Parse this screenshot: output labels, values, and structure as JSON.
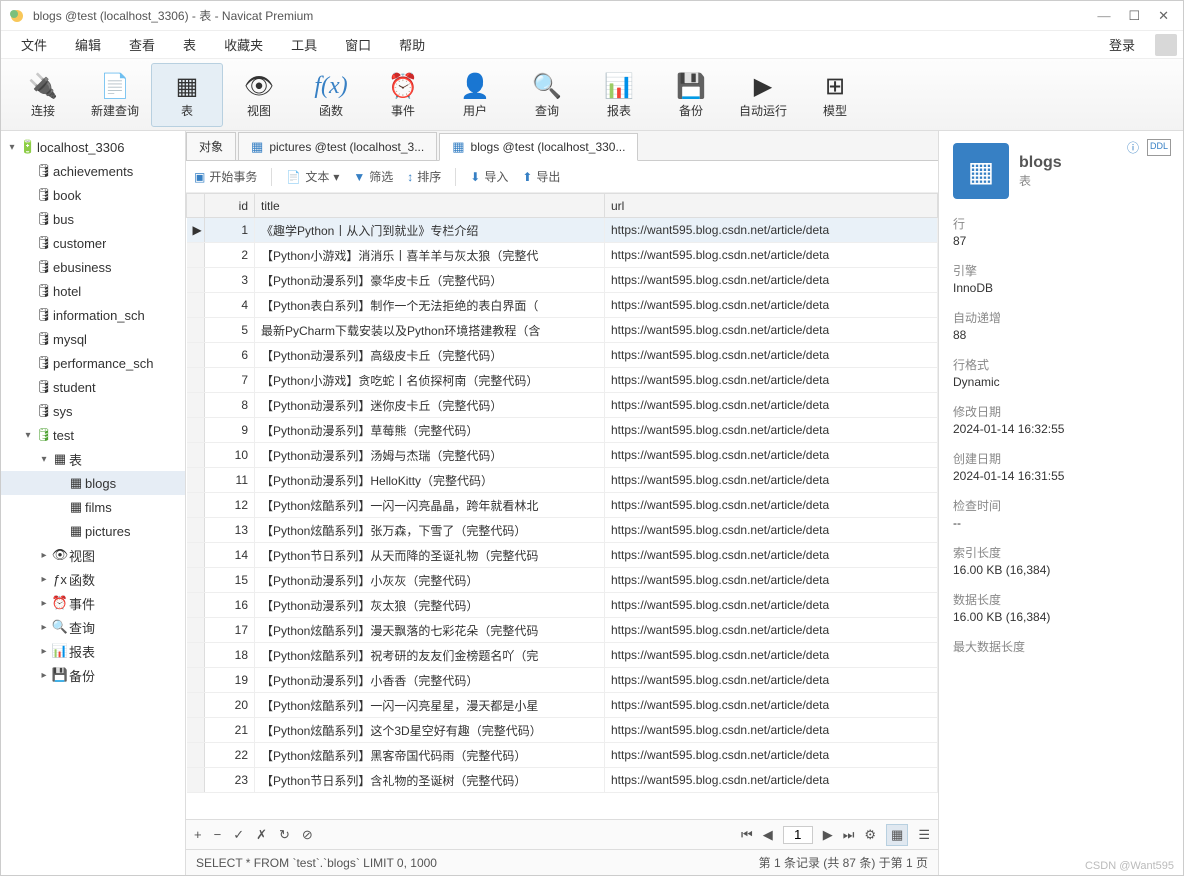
{
  "window": {
    "title": "blogs @test (localhost_3306) - 表 - Navicat Premium"
  },
  "menu": {
    "items": [
      "文件",
      "编辑",
      "查看",
      "表",
      "收藏夹",
      "工具",
      "窗口",
      "帮助"
    ],
    "login": "登录"
  },
  "toolbar": [
    {
      "label": "连接",
      "icon": "🔌"
    },
    {
      "label": "新建查询",
      "icon": "📄"
    },
    {
      "label": "表",
      "icon": "▦",
      "active": true
    },
    {
      "label": "视图",
      "icon": "👁"
    },
    {
      "label": "函数",
      "icon": "f(x)",
      "fx": true
    },
    {
      "label": "事件",
      "icon": "⏰"
    },
    {
      "label": "用户",
      "icon": "👤"
    },
    {
      "label": "查询",
      "icon": "🔍"
    },
    {
      "label": "报表",
      "icon": "📊"
    },
    {
      "label": "备份",
      "icon": "💾"
    },
    {
      "label": "自动运行",
      "icon": "▶"
    },
    {
      "label": "模型",
      "icon": "⊞"
    }
  ],
  "tree": {
    "conn": "localhost_3306",
    "dbs": [
      "achievements",
      "book",
      "bus",
      "customer",
      "ebusiness",
      "hotel",
      "information_sch",
      "mysql",
      "performance_sch",
      "student",
      "sys"
    ],
    "activeDb": "test",
    "tablesLabel": "表",
    "tables": [
      "blogs",
      "films",
      "pictures"
    ],
    "activeTable": "blogs",
    "folders": [
      "视图",
      "函数",
      "事件",
      "查询",
      "报表",
      "备份"
    ]
  },
  "tabs": [
    {
      "label": "对象",
      "icon": ""
    },
    {
      "label": "pictures @test (localhost_3...",
      "icon": "▦"
    },
    {
      "label": "blogs @test (localhost_330...",
      "icon": "▦",
      "active": true
    }
  ],
  "subToolbar": {
    "begin": "开始事务",
    "text": "文本",
    "filter": "筛选",
    "sort": "排序",
    "import": "导入",
    "export": "导出"
  },
  "columns": [
    "id",
    "title",
    "url"
  ],
  "rows": [
    {
      "id": 1,
      "title": "《趣学Python丨从入门到就业》专栏介绍",
      "url": "https://want595.blog.csdn.net/article/deta"
    },
    {
      "id": 2,
      "title": "【Python小游戏】消消乐丨喜羊羊与灰太狼（完整代",
      "url": "https://want595.blog.csdn.net/article/deta"
    },
    {
      "id": 3,
      "title": "【Python动漫系列】豪华皮卡丘（完整代码）",
      "url": "https://want595.blog.csdn.net/article/deta"
    },
    {
      "id": 4,
      "title": "【Python表白系列】制作一个无法拒绝的表白界面（",
      "url": "https://want595.blog.csdn.net/article/deta"
    },
    {
      "id": 5,
      "title": "最新PyCharm下载安装以及Python环境搭建教程（含",
      "url": "https://want595.blog.csdn.net/article/deta"
    },
    {
      "id": 6,
      "title": "【Python动漫系列】高级皮卡丘（完整代码）",
      "url": "https://want595.blog.csdn.net/article/deta"
    },
    {
      "id": 7,
      "title": "【Python小游戏】贪吃蛇丨名侦探柯南（完整代码）",
      "url": "https://want595.blog.csdn.net/article/deta"
    },
    {
      "id": 8,
      "title": "【Python动漫系列】迷你皮卡丘（完整代码）",
      "url": "https://want595.blog.csdn.net/article/deta"
    },
    {
      "id": 9,
      "title": "【Python动漫系列】草莓熊（完整代码）",
      "url": "https://want595.blog.csdn.net/article/deta"
    },
    {
      "id": 10,
      "title": "【Python动漫系列】汤姆与杰瑞（完整代码）",
      "url": "https://want595.blog.csdn.net/article/deta"
    },
    {
      "id": 11,
      "title": "【Python动漫系列】HelloKitty（完整代码）",
      "url": "https://want595.blog.csdn.net/article/deta"
    },
    {
      "id": 12,
      "title": "【Python炫酷系列】一闪一闪亮晶晶，跨年就看林北",
      "url": "https://want595.blog.csdn.net/article/deta"
    },
    {
      "id": 13,
      "title": "【Python炫酷系列】张万森，下雪了（完整代码）",
      "url": "https://want595.blog.csdn.net/article/deta"
    },
    {
      "id": 14,
      "title": "【Python节日系列】从天而降的圣诞礼物（完整代码",
      "url": "https://want595.blog.csdn.net/article/deta"
    },
    {
      "id": 15,
      "title": "【Python动漫系列】小灰灰（完整代码）",
      "url": "https://want595.blog.csdn.net/article/deta"
    },
    {
      "id": 16,
      "title": "【Python动漫系列】灰太狼（完整代码）",
      "url": "https://want595.blog.csdn.net/article/deta"
    },
    {
      "id": 17,
      "title": "【Python炫酷系列】漫天飘落的七彩花朵（完整代码",
      "url": "https://want595.blog.csdn.net/article/deta"
    },
    {
      "id": 18,
      "title": "【Python炫酷系列】祝考研的友友们金榜题名吖（完",
      "url": "https://want595.blog.csdn.net/article/deta"
    },
    {
      "id": 19,
      "title": "【Python动漫系列】小香香（完整代码）",
      "url": "https://want595.blog.csdn.net/article/deta"
    },
    {
      "id": 20,
      "title": "【Python炫酷系列】一闪一闪亮星星，漫天都是小星",
      "url": "https://want595.blog.csdn.net/article/deta"
    },
    {
      "id": 21,
      "title": "【Python炫酷系列】这个3D星空好有趣（完整代码）",
      "url": "https://want595.blog.csdn.net/article/deta"
    },
    {
      "id": 22,
      "title": "【Python炫酷系列】黑客帝国代码雨（完整代码）",
      "url": "https://want595.blog.csdn.net/article/deta"
    },
    {
      "id": 23,
      "title": "【Python节日系列】含礼物的圣诞树（完整代码）",
      "url": "https://want595.blog.csdn.net/article/deta"
    }
  ],
  "gridFooter": {
    "page": "1"
  },
  "status": {
    "sql": "SELECT * FROM `test`.`blogs` LIMIT 0, 1000",
    "info": "第 1 条记录 (共 87 条) 于第 1 页"
  },
  "rightPanel": {
    "name": "blogs",
    "type": "表",
    "props": [
      {
        "label": "行",
        "value": "87"
      },
      {
        "label": "引擎",
        "value": "InnoDB"
      },
      {
        "label": "自动递增",
        "value": "88"
      },
      {
        "label": "行格式",
        "value": "Dynamic"
      },
      {
        "label": "修改日期",
        "value": "2024-01-14 16:32:55"
      },
      {
        "label": "创建日期",
        "value": "2024-01-14 16:31:55"
      },
      {
        "label": "检查时间",
        "value": "--"
      },
      {
        "label": "索引长度",
        "value": "16.00 KB (16,384)"
      },
      {
        "label": "数据长度",
        "value": "16.00 KB (16,384)"
      },
      {
        "label": "最大数据长度",
        "value": ""
      }
    ]
  },
  "watermark": "CSDN @Want595"
}
